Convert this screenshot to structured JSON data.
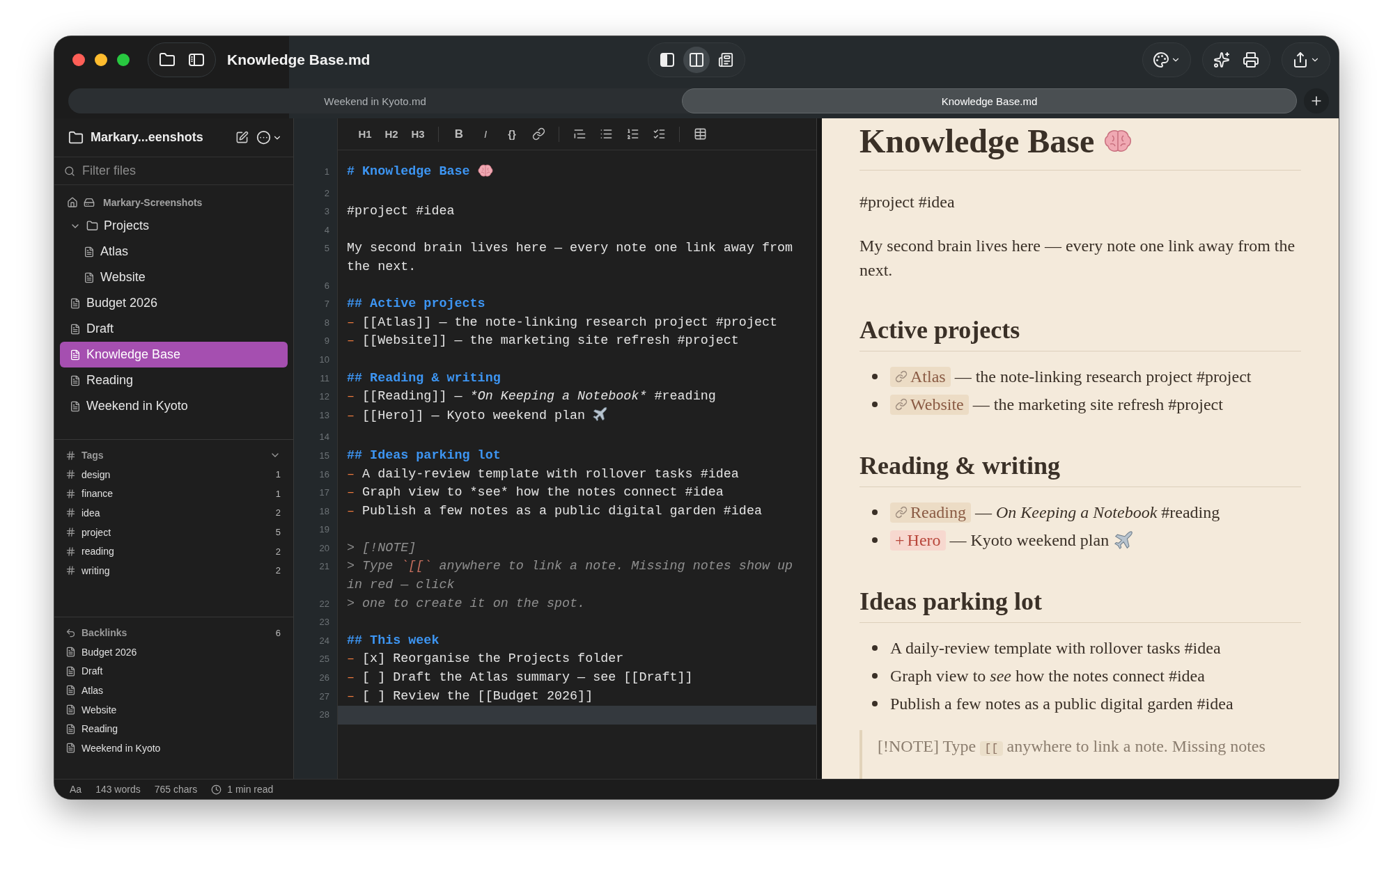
{
  "window": {
    "title": "Knowledge Base.md"
  },
  "view_modes": [
    {
      "kind": "editor",
      "selected": false
    },
    {
      "kind": "split",
      "selected": true
    },
    {
      "kind": "preview",
      "selected": false
    }
  ],
  "tabs": [
    {
      "label": "Weekend in Kyoto.md",
      "selected": false
    },
    {
      "label": "Knowledge Base.md",
      "selected": true
    }
  ],
  "sidebar": {
    "folder": "Markary...eenshots",
    "filter_placeholder": "Filter files",
    "root": "Markary-Screenshots",
    "tree": [
      {
        "kind": "folder",
        "label": "Projects",
        "expanded": true,
        "selected": false,
        "children": [
          {
            "kind": "file",
            "label": "Atlas",
            "selected": false
          },
          {
            "kind": "file",
            "label": "Website",
            "selected": false
          }
        ]
      },
      {
        "kind": "file",
        "label": "Budget 2026",
        "selected": false
      },
      {
        "kind": "file",
        "label": "Draft",
        "selected": false
      },
      {
        "kind": "file",
        "label": "Knowledge Base",
        "selected": true
      },
      {
        "kind": "file",
        "label": "Reading",
        "selected": false
      },
      {
        "kind": "file",
        "label": "Weekend in Kyoto",
        "selected": false
      }
    ],
    "tags": {
      "title": "Tags",
      "expanded": true,
      "items": [
        {
          "name": "design",
          "count": "1"
        },
        {
          "name": "finance",
          "count": "1"
        },
        {
          "name": "idea",
          "count": "2"
        },
        {
          "name": "project",
          "count": "5"
        },
        {
          "name": "reading",
          "count": "2"
        },
        {
          "name": "writing",
          "count": "2"
        }
      ]
    },
    "backlinks": {
      "title": "Backlinks",
      "count": "6",
      "items": [
        "Budget 2026",
        "Draft",
        "Atlas",
        "Website",
        "Reading",
        "Weekend in Kyoto"
      ]
    }
  },
  "editor": {
    "toolbar": [
      [
        {
          "kind": "text",
          "label": "H1"
        },
        {
          "kind": "text",
          "label": "H2"
        },
        {
          "kind": "text",
          "label": "H3"
        }
      ],
      [
        {
          "kind": "bold",
          "label": "B"
        },
        {
          "kind": "italic",
          "label": "I"
        },
        {
          "kind": "text",
          "label": "{}"
        },
        {
          "kind": "link"
        }
      ],
      [
        {
          "kind": "quote"
        },
        {
          "kind": "bullets"
        },
        {
          "kind": "numbers"
        },
        {
          "kind": "tasks"
        }
      ],
      [
        {
          "kind": "table"
        }
      ]
    ],
    "lines": [
      {
        "number": "1",
        "current": false,
        "segments": [
          {
            "kind": "heading",
            "text": "# Knowledge Base "
          },
          {
            "kind": "brain"
          }
        ]
      },
      {
        "number": "2",
        "current": false
      },
      {
        "number": "3",
        "current": false,
        "segments": [
          {
            "kind": "plain",
            "text": "#project #idea"
          }
        ]
      },
      {
        "number": "4",
        "current": false
      },
      {
        "number": "5",
        "current": false,
        "segments": [
          {
            "kind": "plain",
            "text": "My second brain lives here — every note one link away from the next."
          }
        ]
      },
      {
        "number": "6",
        "current": false
      },
      {
        "number": "7",
        "current": false,
        "segments": [
          {
            "kind": "heading",
            "text": "## Active projects"
          }
        ]
      },
      {
        "number": "8",
        "current": false,
        "segments": [
          {
            "kind": "marker",
            "text": "– "
          },
          {
            "kind": "plain",
            "text": "[[Atlas]] — the note-linking research project #project"
          }
        ]
      },
      {
        "number": "9",
        "current": false,
        "segments": [
          {
            "kind": "marker",
            "text": "– "
          },
          {
            "kind": "plain",
            "text": "[[Website]] — the marketing site refresh #project"
          }
        ]
      },
      {
        "number": "10",
        "current": false
      },
      {
        "number": "11",
        "current": false,
        "segments": [
          {
            "kind": "heading",
            "text": "## Reading & writing"
          }
        ]
      },
      {
        "number": "12",
        "current": false,
        "segments": [
          {
            "kind": "marker",
            "text": "– "
          },
          {
            "kind": "plain",
            "text": "[[Reading]] — "
          },
          {
            "kind": "emph",
            "text": "*On Keeping a Notebook*"
          },
          {
            "kind": "plain",
            "text": " #reading"
          }
        ]
      },
      {
        "number": "13",
        "current": false,
        "segments": [
          {
            "kind": "marker",
            "text": "– "
          },
          {
            "kind": "plain",
            "text": "[[Hero]] — Kyoto weekend plan "
          },
          {
            "kind": "airplane"
          }
        ]
      },
      {
        "number": "14",
        "current": false
      },
      {
        "number": "15",
        "current": false,
        "segments": [
          {
            "kind": "heading",
            "text": "## Ideas parking lot"
          }
        ]
      },
      {
        "number": "16",
        "current": false,
        "segments": [
          {
            "kind": "marker",
            "text": "– "
          },
          {
            "kind": "plain",
            "text": "A daily-review template with rollover tasks #idea"
          }
        ]
      },
      {
        "number": "17",
        "current": false,
        "segments": [
          {
            "kind": "marker",
            "text": "– "
          },
          {
            "kind": "plain",
            "text": "Graph view to *see* how the notes connect #idea"
          }
        ]
      },
      {
        "number": "18",
        "current": false,
        "segments": [
          {
            "kind": "marker",
            "text": "– "
          },
          {
            "kind": "plain",
            "text": "Publish a few notes as a public digital garden #idea"
          }
        ]
      },
      {
        "number": "19",
        "current": false
      },
      {
        "number": "20",
        "current": false,
        "segments": [
          {
            "kind": "quote",
            "text": "> [!NOTE]"
          }
        ]
      },
      {
        "number": "21",
        "current": false,
        "segments": [
          {
            "kind": "quote",
            "text": "> Type "
          },
          {
            "kind": "code",
            "text": "`[[`"
          },
          {
            "kind": "quote",
            "text": " anywhere to link a note. Missing notes show up in red — click"
          }
        ]
      },
      {
        "number": "22",
        "current": false,
        "segments": [
          {
            "kind": "quote",
            "text": "> one to create it on the spot."
          }
        ]
      },
      {
        "number": "23",
        "current": false
      },
      {
        "number": "24",
        "current": false,
        "segments": [
          {
            "kind": "heading",
            "text": "## This week"
          }
        ]
      },
      {
        "number": "25",
        "current": false,
        "segments": [
          {
            "kind": "marker",
            "text": "– "
          },
          {
            "kind": "plain",
            "text": "[x] Reorganise the Projects folder"
          }
        ]
      },
      {
        "number": "26",
        "current": false,
        "segments": [
          {
            "kind": "marker",
            "text": "– "
          },
          {
            "kind": "plain",
            "text": "[ ] Draft the Atlas summary — see [[Draft]]"
          }
        ]
      },
      {
        "number": "27",
        "current": false,
        "segments": [
          {
            "kind": "marker",
            "text": "– "
          },
          {
            "kind": "plain",
            "text": "[ ] Review the [[Budget 2026]]"
          }
        ]
      },
      {
        "number": "28",
        "current": true
      }
    ]
  },
  "preview": {
    "blocks": [
      {
        "kind": "h1",
        "segments": [
          {
            "kind": "plain",
            "text": "Knowledge Base"
          },
          {
            "kind": "brain"
          }
        ]
      },
      {
        "kind": "p",
        "text": "#project #idea"
      },
      {
        "kind": "p",
        "text": "My second brain lives here — every note one link away from the next."
      },
      {
        "kind": "h2",
        "text": "Active projects"
      },
      {
        "kind": "list",
        "items": [
          {
            "segments": [
              {
                "kind": "link",
                "text": "Atlas"
              },
              {
                "kind": "plain",
                "text": " — the note-linking research project #project"
              }
            ]
          },
          {
            "segments": [
              {
                "kind": "link",
                "text": "Website"
              },
              {
                "kind": "plain",
                "text": " — the marketing site refresh #project"
              }
            ]
          }
        ]
      },
      {
        "kind": "h2",
        "text": "Reading & writing"
      },
      {
        "kind": "list",
        "items": [
          {
            "segments": [
              {
                "kind": "link",
                "text": "Reading"
              },
              {
                "kind": "plain",
                "text": " — "
              },
              {
                "kind": "emph",
                "text": "On Keeping a Notebook"
              },
              {
                "kind": "plain",
                "text": " #reading"
              }
            ]
          },
          {
            "segments": [
              {
                "kind": "missing",
                "marker": "+",
                "text": "Hero"
              },
              {
                "kind": "plain",
                "text": " — Kyoto weekend plan"
              },
              {
                "kind": "airplane"
              }
            ]
          }
        ]
      },
      {
        "kind": "h2",
        "text": "Ideas parking lot"
      },
      {
        "kind": "list",
        "items": [
          {
            "segments": [
              {
                "kind": "plain",
                "text": "A daily-review template with rollover tasks #idea"
              }
            ]
          },
          {
            "segments": [
              {
                "kind": "plain",
                "text": "Graph view to "
              },
              {
                "kind": "emph",
                "text": "see"
              },
              {
                "kind": "plain",
                "text": " how the notes connect #idea"
              }
            ]
          },
          {
            "segments": [
              {
                "kind": "plain",
                "text": "Publish a few notes as a public digital garden #idea"
              }
            ]
          }
        ]
      },
      {
        "kind": "note",
        "segments": [
          {
            "kind": "plain",
            "text": "[!NOTE] Type "
          },
          {
            "kind": "code",
            "text": "[["
          },
          {
            "kind": "plain",
            "text": " anywhere to link a note. Missing notes"
          }
        ]
      }
    ]
  },
  "status": {
    "font": "Aa",
    "words": "143 words",
    "chars": "765 chars",
    "read": "1 min read"
  }
}
